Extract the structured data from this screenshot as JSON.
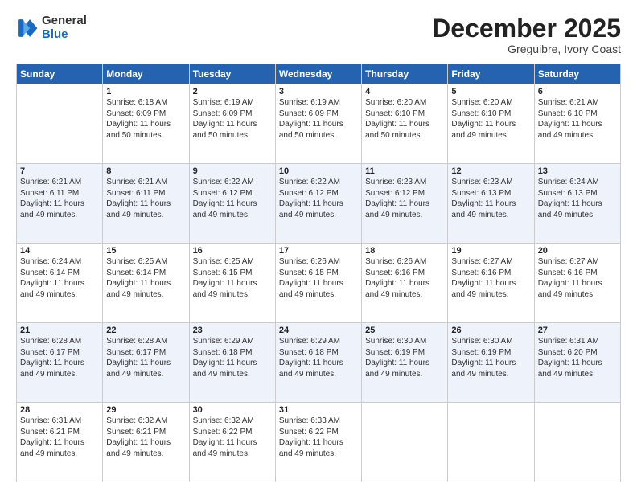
{
  "header": {
    "logo": {
      "general": "General",
      "blue": "Blue"
    },
    "month": "December 2025",
    "location": "Greguibre, Ivory Coast"
  },
  "days_of_week": [
    "Sunday",
    "Monday",
    "Tuesday",
    "Wednesday",
    "Thursday",
    "Friday",
    "Saturday"
  ],
  "weeks": [
    [
      {
        "day": "",
        "sunrise": "",
        "sunset": "",
        "daylight": ""
      },
      {
        "day": "1",
        "sunrise": "Sunrise: 6:18 AM",
        "sunset": "Sunset: 6:09 PM",
        "daylight": "Daylight: 11 hours and 50 minutes."
      },
      {
        "day": "2",
        "sunrise": "Sunrise: 6:19 AM",
        "sunset": "Sunset: 6:09 PM",
        "daylight": "Daylight: 11 hours and 50 minutes."
      },
      {
        "day": "3",
        "sunrise": "Sunrise: 6:19 AM",
        "sunset": "Sunset: 6:09 PM",
        "daylight": "Daylight: 11 hours and 50 minutes."
      },
      {
        "day": "4",
        "sunrise": "Sunrise: 6:20 AM",
        "sunset": "Sunset: 6:10 PM",
        "daylight": "Daylight: 11 hours and 50 minutes."
      },
      {
        "day": "5",
        "sunrise": "Sunrise: 6:20 AM",
        "sunset": "Sunset: 6:10 PM",
        "daylight": "Daylight: 11 hours and 49 minutes."
      },
      {
        "day": "6",
        "sunrise": "Sunrise: 6:21 AM",
        "sunset": "Sunset: 6:10 PM",
        "daylight": "Daylight: 11 hours and 49 minutes."
      }
    ],
    [
      {
        "day": "7",
        "sunrise": "Sunrise: 6:21 AM",
        "sunset": "Sunset: 6:11 PM",
        "daylight": "Daylight: 11 hours and 49 minutes."
      },
      {
        "day": "8",
        "sunrise": "Sunrise: 6:21 AM",
        "sunset": "Sunset: 6:11 PM",
        "daylight": "Daylight: 11 hours and 49 minutes."
      },
      {
        "day": "9",
        "sunrise": "Sunrise: 6:22 AM",
        "sunset": "Sunset: 6:12 PM",
        "daylight": "Daylight: 11 hours and 49 minutes."
      },
      {
        "day": "10",
        "sunrise": "Sunrise: 6:22 AM",
        "sunset": "Sunset: 6:12 PM",
        "daylight": "Daylight: 11 hours and 49 minutes."
      },
      {
        "day": "11",
        "sunrise": "Sunrise: 6:23 AM",
        "sunset": "Sunset: 6:12 PM",
        "daylight": "Daylight: 11 hours and 49 minutes."
      },
      {
        "day": "12",
        "sunrise": "Sunrise: 6:23 AM",
        "sunset": "Sunset: 6:13 PM",
        "daylight": "Daylight: 11 hours and 49 minutes."
      },
      {
        "day": "13",
        "sunrise": "Sunrise: 6:24 AM",
        "sunset": "Sunset: 6:13 PM",
        "daylight": "Daylight: 11 hours and 49 minutes."
      }
    ],
    [
      {
        "day": "14",
        "sunrise": "Sunrise: 6:24 AM",
        "sunset": "Sunset: 6:14 PM",
        "daylight": "Daylight: 11 hours and 49 minutes."
      },
      {
        "day": "15",
        "sunrise": "Sunrise: 6:25 AM",
        "sunset": "Sunset: 6:14 PM",
        "daylight": "Daylight: 11 hours and 49 minutes."
      },
      {
        "day": "16",
        "sunrise": "Sunrise: 6:25 AM",
        "sunset": "Sunset: 6:15 PM",
        "daylight": "Daylight: 11 hours and 49 minutes."
      },
      {
        "day": "17",
        "sunrise": "Sunrise: 6:26 AM",
        "sunset": "Sunset: 6:15 PM",
        "daylight": "Daylight: 11 hours and 49 minutes."
      },
      {
        "day": "18",
        "sunrise": "Sunrise: 6:26 AM",
        "sunset": "Sunset: 6:16 PM",
        "daylight": "Daylight: 11 hours and 49 minutes."
      },
      {
        "day": "19",
        "sunrise": "Sunrise: 6:27 AM",
        "sunset": "Sunset: 6:16 PM",
        "daylight": "Daylight: 11 hours and 49 minutes."
      },
      {
        "day": "20",
        "sunrise": "Sunrise: 6:27 AM",
        "sunset": "Sunset: 6:16 PM",
        "daylight": "Daylight: 11 hours and 49 minutes."
      }
    ],
    [
      {
        "day": "21",
        "sunrise": "Sunrise: 6:28 AM",
        "sunset": "Sunset: 6:17 PM",
        "daylight": "Daylight: 11 hours and 49 minutes."
      },
      {
        "day": "22",
        "sunrise": "Sunrise: 6:28 AM",
        "sunset": "Sunset: 6:17 PM",
        "daylight": "Daylight: 11 hours and 49 minutes."
      },
      {
        "day": "23",
        "sunrise": "Sunrise: 6:29 AM",
        "sunset": "Sunset: 6:18 PM",
        "daylight": "Daylight: 11 hours and 49 minutes."
      },
      {
        "day": "24",
        "sunrise": "Sunrise: 6:29 AM",
        "sunset": "Sunset: 6:18 PM",
        "daylight": "Daylight: 11 hours and 49 minutes."
      },
      {
        "day": "25",
        "sunrise": "Sunrise: 6:30 AM",
        "sunset": "Sunset: 6:19 PM",
        "daylight": "Daylight: 11 hours and 49 minutes."
      },
      {
        "day": "26",
        "sunrise": "Sunrise: 6:30 AM",
        "sunset": "Sunset: 6:19 PM",
        "daylight": "Daylight: 11 hours and 49 minutes."
      },
      {
        "day": "27",
        "sunrise": "Sunrise: 6:31 AM",
        "sunset": "Sunset: 6:20 PM",
        "daylight": "Daylight: 11 hours and 49 minutes."
      }
    ],
    [
      {
        "day": "28",
        "sunrise": "Sunrise: 6:31 AM",
        "sunset": "Sunset: 6:21 PM",
        "daylight": "Daylight: 11 hours and 49 minutes."
      },
      {
        "day": "29",
        "sunrise": "Sunrise: 6:32 AM",
        "sunset": "Sunset: 6:21 PM",
        "daylight": "Daylight: 11 hours and 49 minutes."
      },
      {
        "day": "30",
        "sunrise": "Sunrise: 6:32 AM",
        "sunset": "Sunset: 6:22 PM",
        "daylight": "Daylight: 11 hours and 49 minutes."
      },
      {
        "day": "31",
        "sunrise": "Sunrise: 6:33 AM",
        "sunset": "Sunset: 6:22 PM",
        "daylight": "Daylight: 11 hours and 49 minutes."
      },
      {
        "day": "",
        "sunrise": "",
        "sunset": "",
        "daylight": ""
      },
      {
        "day": "",
        "sunrise": "",
        "sunset": "",
        "daylight": ""
      },
      {
        "day": "",
        "sunrise": "",
        "sunset": "",
        "daylight": ""
      }
    ]
  ]
}
